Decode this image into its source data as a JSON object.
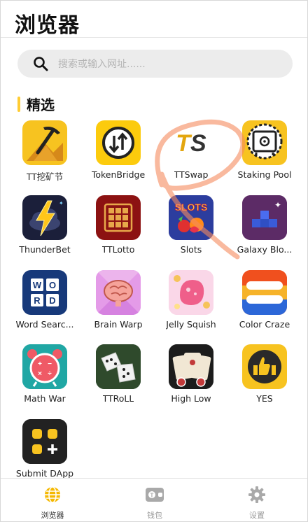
{
  "header": {
    "title": "浏览器"
  },
  "search": {
    "placeholder": "搜索或输入网址......"
  },
  "section": {
    "title": "精选"
  },
  "apps": [
    {
      "name": "TT挖矿节"
    },
    {
      "name": "TokenBridge"
    },
    {
      "name": "TTSwap"
    },
    {
      "name": "Staking Pool"
    },
    {
      "name": "ThunderBet"
    },
    {
      "name": "TTLotto"
    },
    {
      "name": "Slots"
    },
    {
      "name": "Galaxy Blo..."
    },
    {
      "name": "Word Searc..."
    },
    {
      "name": "Brain Warp"
    },
    {
      "name": "Jelly Squish"
    },
    {
      "name": "Color Craze"
    },
    {
      "name": "Math War"
    },
    {
      "name": "TTRoLL"
    },
    {
      "name": "High Low"
    },
    {
      "name": "YES"
    },
    {
      "name": "Submit DApp"
    }
  ],
  "icon_text": {
    "ttswap": "TS",
    "slots": "SLOTS"
  },
  "tabs": [
    {
      "label": "浏览器",
      "icon": "globe-icon",
      "active": true
    },
    {
      "label": "钱包",
      "icon": "wallet-icon",
      "active": false
    },
    {
      "label": "设置",
      "icon": "gear-icon",
      "active": false
    }
  ],
  "colors": {
    "accent": "#ffcc33",
    "tab_active": "#f5b800"
  }
}
